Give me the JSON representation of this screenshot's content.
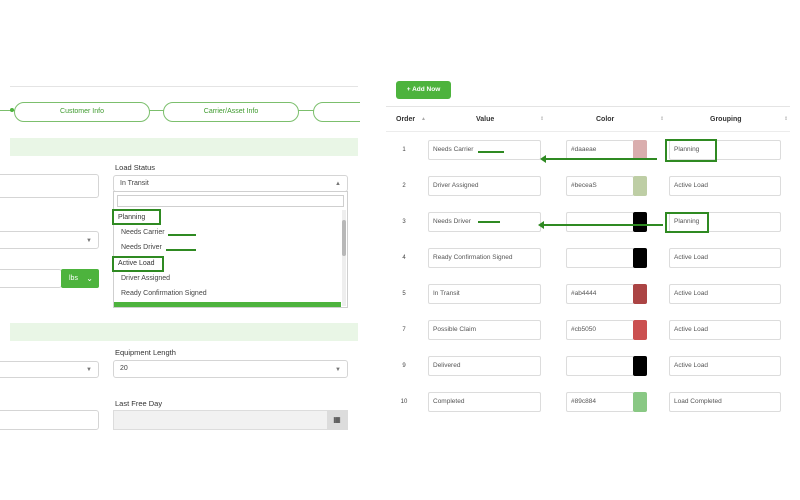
{
  "left": {
    "steps": [
      "Customer Info",
      "Carrier/Asset Info"
    ],
    "load_status": {
      "label": "Load Status",
      "value": "In Transit",
      "dropdown": {
        "groups": [
          {
            "name": "Planning",
            "items": [
              "Needs Carrier",
              "Needs Driver"
            ]
          },
          {
            "name": "Active Load",
            "items": [
              "Driver Assigned",
              "Ready Confirmation Signed"
            ]
          }
        ]
      }
    },
    "unit_button": "lbs",
    "equipment_length": {
      "label": "Equipment Length",
      "value": "20"
    },
    "last_free_day": {
      "label": "Last Free Day"
    }
  },
  "right": {
    "add_button": "+ Add Now",
    "headers": {
      "order": "Order",
      "value": "Value",
      "color": "Color",
      "grouping": "Grouping"
    },
    "rows": [
      {
        "order": "1",
        "value": "Needs Carrier",
        "color_text": "#daaeae",
        "swatch": "#daaeae",
        "grouping": "Planning"
      },
      {
        "order": "2",
        "value": "Driver Assigned",
        "color_text": "#beceaS",
        "swatch": "#becea5",
        "grouping": "Active Load"
      },
      {
        "order": "3",
        "value": "Needs Driver",
        "color_text": "",
        "swatch": "#000000",
        "grouping": "Planning"
      },
      {
        "order": "4",
        "value": "Ready Confirmation Signed",
        "color_text": "",
        "swatch": "#000000",
        "grouping": "Active Load"
      },
      {
        "order": "5",
        "value": "In Transit",
        "color_text": "#ab4444",
        "swatch": "#ab4444",
        "grouping": "Active Load"
      },
      {
        "order": "7",
        "value": "Possible Claim",
        "color_text": "#cb5050",
        "swatch": "#cb5050",
        "grouping": "Active Load"
      },
      {
        "order": "9",
        "value": "Delivered",
        "color_text": "",
        "swatch": "#000000",
        "grouping": "Active Load"
      },
      {
        "order": "10",
        "value": "Completed",
        "color_text": "#89c884",
        "swatch": "#89c884",
        "grouping": "Load Completed"
      }
    ]
  },
  "colors": {
    "accent": "#4db33d",
    "annotation": "#2f8a22",
    "band": "#e9f6e6"
  }
}
